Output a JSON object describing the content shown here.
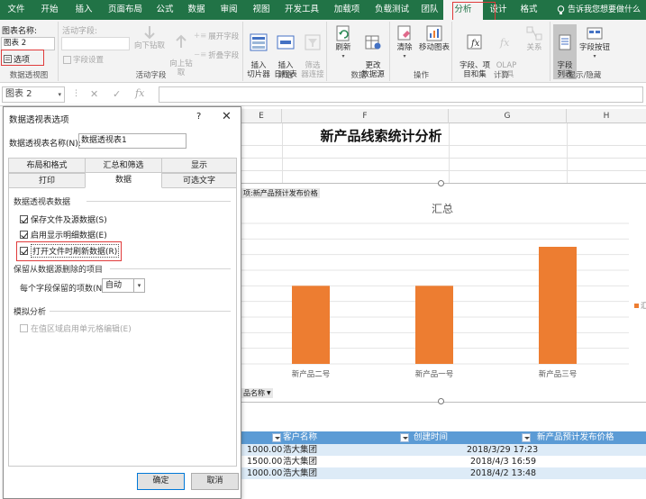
{
  "ribbon": {
    "tabs": [
      "文件",
      "开始",
      "插入",
      "页面布局",
      "公式",
      "数据",
      "审阅",
      "视图",
      "开发工具",
      "加载项",
      "负载测试",
      "团队",
      "分析",
      "设计",
      "格式"
    ],
    "active_tab": "分析",
    "tell_me": "告诉我您想要做什么",
    "pivot_group": {
      "name_label": "图表名称:",
      "name_value": "图表 2",
      "options_label": "选项",
      "group_label": "数据透视图"
    },
    "active_field_group": {
      "field_label": "活动字段:",
      "field_settings": "字段设置",
      "drill_down": "向下钻取",
      "drill_up": "向上钻\n取",
      "expand": "展开字段",
      "collapse": "折叠字段",
      "group_label": "活动字段"
    },
    "filter_group": {
      "slicer": "插入\n切片器",
      "timeline": "插入\n日程表",
      "filter_conn": "筛选\n器连接",
      "group_label": "筛选"
    },
    "data_group": {
      "refresh": "刷新",
      "change_source": "更改\n数据源",
      "group_label": "数据"
    },
    "actions_group": {
      "clear": "清除",
      "move": "移动图表",
      "group_label": "操作"
    },
    "calc_group": {
      "fields_items": "字段、项\n目和集",
      "olap": "OLAP\n工具",
      "relations": "关系",
      "group_label": "计算"
    },
    "show_group": {
      "field_list": "字段\n列表",
      "field_buttons": "字段按钮",
      "group_label": "显示/隐藏"
    }
  },
  "formula_bar": {
    "name_box": "图表 2",
    "cancel": "✕",
    "enter": "✓",
    "fx": "fx"
  },
  "columns": [
    "E",
    "F",
    "G",
    "H"
  ],
  "dialog": {
    "title": "数据透视表选项",
    "help": "?",
    "close": "✕",
    "name_label": "数据透视表名称(N):",
    "name_value": "数据透视表1",
    "tabs_row1": [
      "布局和格式",
      "汇总和筛选",
      "显示"
    ],
    "tabs_row2": [
      "打印",
      "数据",
      "可选文字"
    ],
    "active_tab": "数据",
    "section_data": "数据透视表数据",
    "chk_save_source": "保存文件及源数据(S)",
    "chk_enable_detail": "启用显示明细数据(E)",
    "chk_refresh_open": "打开文件时刷新数据(R)",
    "section_retain": "保留从数据源删除的项目",
    "retain_label": "每个字段保留的项数(N):",
    "retain_value": "自动",
    "section_whatif": "模拟分析",
    "chk_whatif": "在值区域启用单元格编辑(E)",
    "ok": "确定",
    "cancel": "取消"
  },
  "sheet": {
    "title": "新产品线索统计分析",
    "value_field_label": "项:新产品预计发布价格",
    "axis_field_label": "品名称",
    "legend_partial": "汇"
  },
  "chart_data": {
    "type": "bar",
    "title": "汇总",
    "categories": [
      "新产品二号",
      "新产品一号",
      "新产品三号"
    ],
    "values": [
      1000,
      1000,
      1500
    ],
    "ylim": [
      0,
      1800
    ],
    "grid": true,
    "legend": "right",
    "color": "#ed7d31"
  },
  "table": {
    "headers": [
      "客户名称",
      "创建时间",
      "新产品预计发布价格"
    ],
    "rows": [
      {
        "price": "1000.00",
        "customer": "浩大集团",
        "created": "2018/3/29 17:23"
      },
      {
        "price": "1500.00",
        "customer": "浩大集团",
        "created": "2018/4/3 16:59"
      },
      {
        "price": "1000.00",
        "customer": "浩大集团",
        "created": "2018/4/2 13:48"
      }
    ]
  }
}
